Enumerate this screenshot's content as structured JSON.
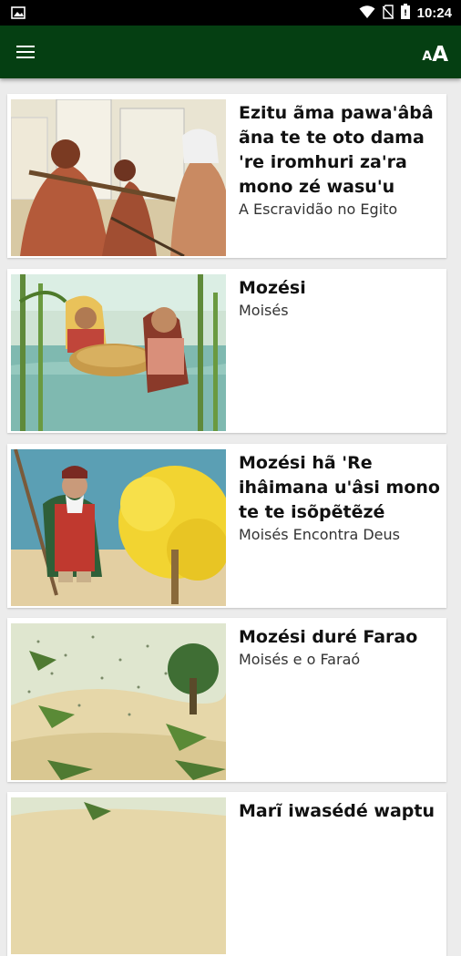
{
  "status_bar": {
    "time": "10:24",
    "icons": [
      "image-icon",
      "wifi-icon",
      "no-sim-icon",
      "battery-icon"
    ]
  },
  "app_bar": {
    "menu_icon": "hamburger-menu-icon",
    "text_size_icon": "text-size-icon",
    "text_size_small": "A",
    "text_size_big": "A",
    "background_color": "#053f12"
  },
  "stories": [
    {
      "title": "Ezitu ãma pawa'âbâ ãna te te oto dama 're iromhuri za'ra mono zé wasu'u",
      "subtitle": "A Escravidão no Egito"
    },
    {
      "title": "Mozési",
      "subtitle": "Moisés"
    },
    {
      "title": "Mozési hã 'Re ihâimana u'âsi mono te te isõpẽtẽzé",
      "subtitle": "Moisés Encontra Deus"
    },
    {
      "title": "Mozési duré Farao",
      "subtitle": "Moisés e o Faraó"
    },
    {
      "title": "Marĩ iwasédé waptu",
      "subtitle": ""
    }
  ]
}
